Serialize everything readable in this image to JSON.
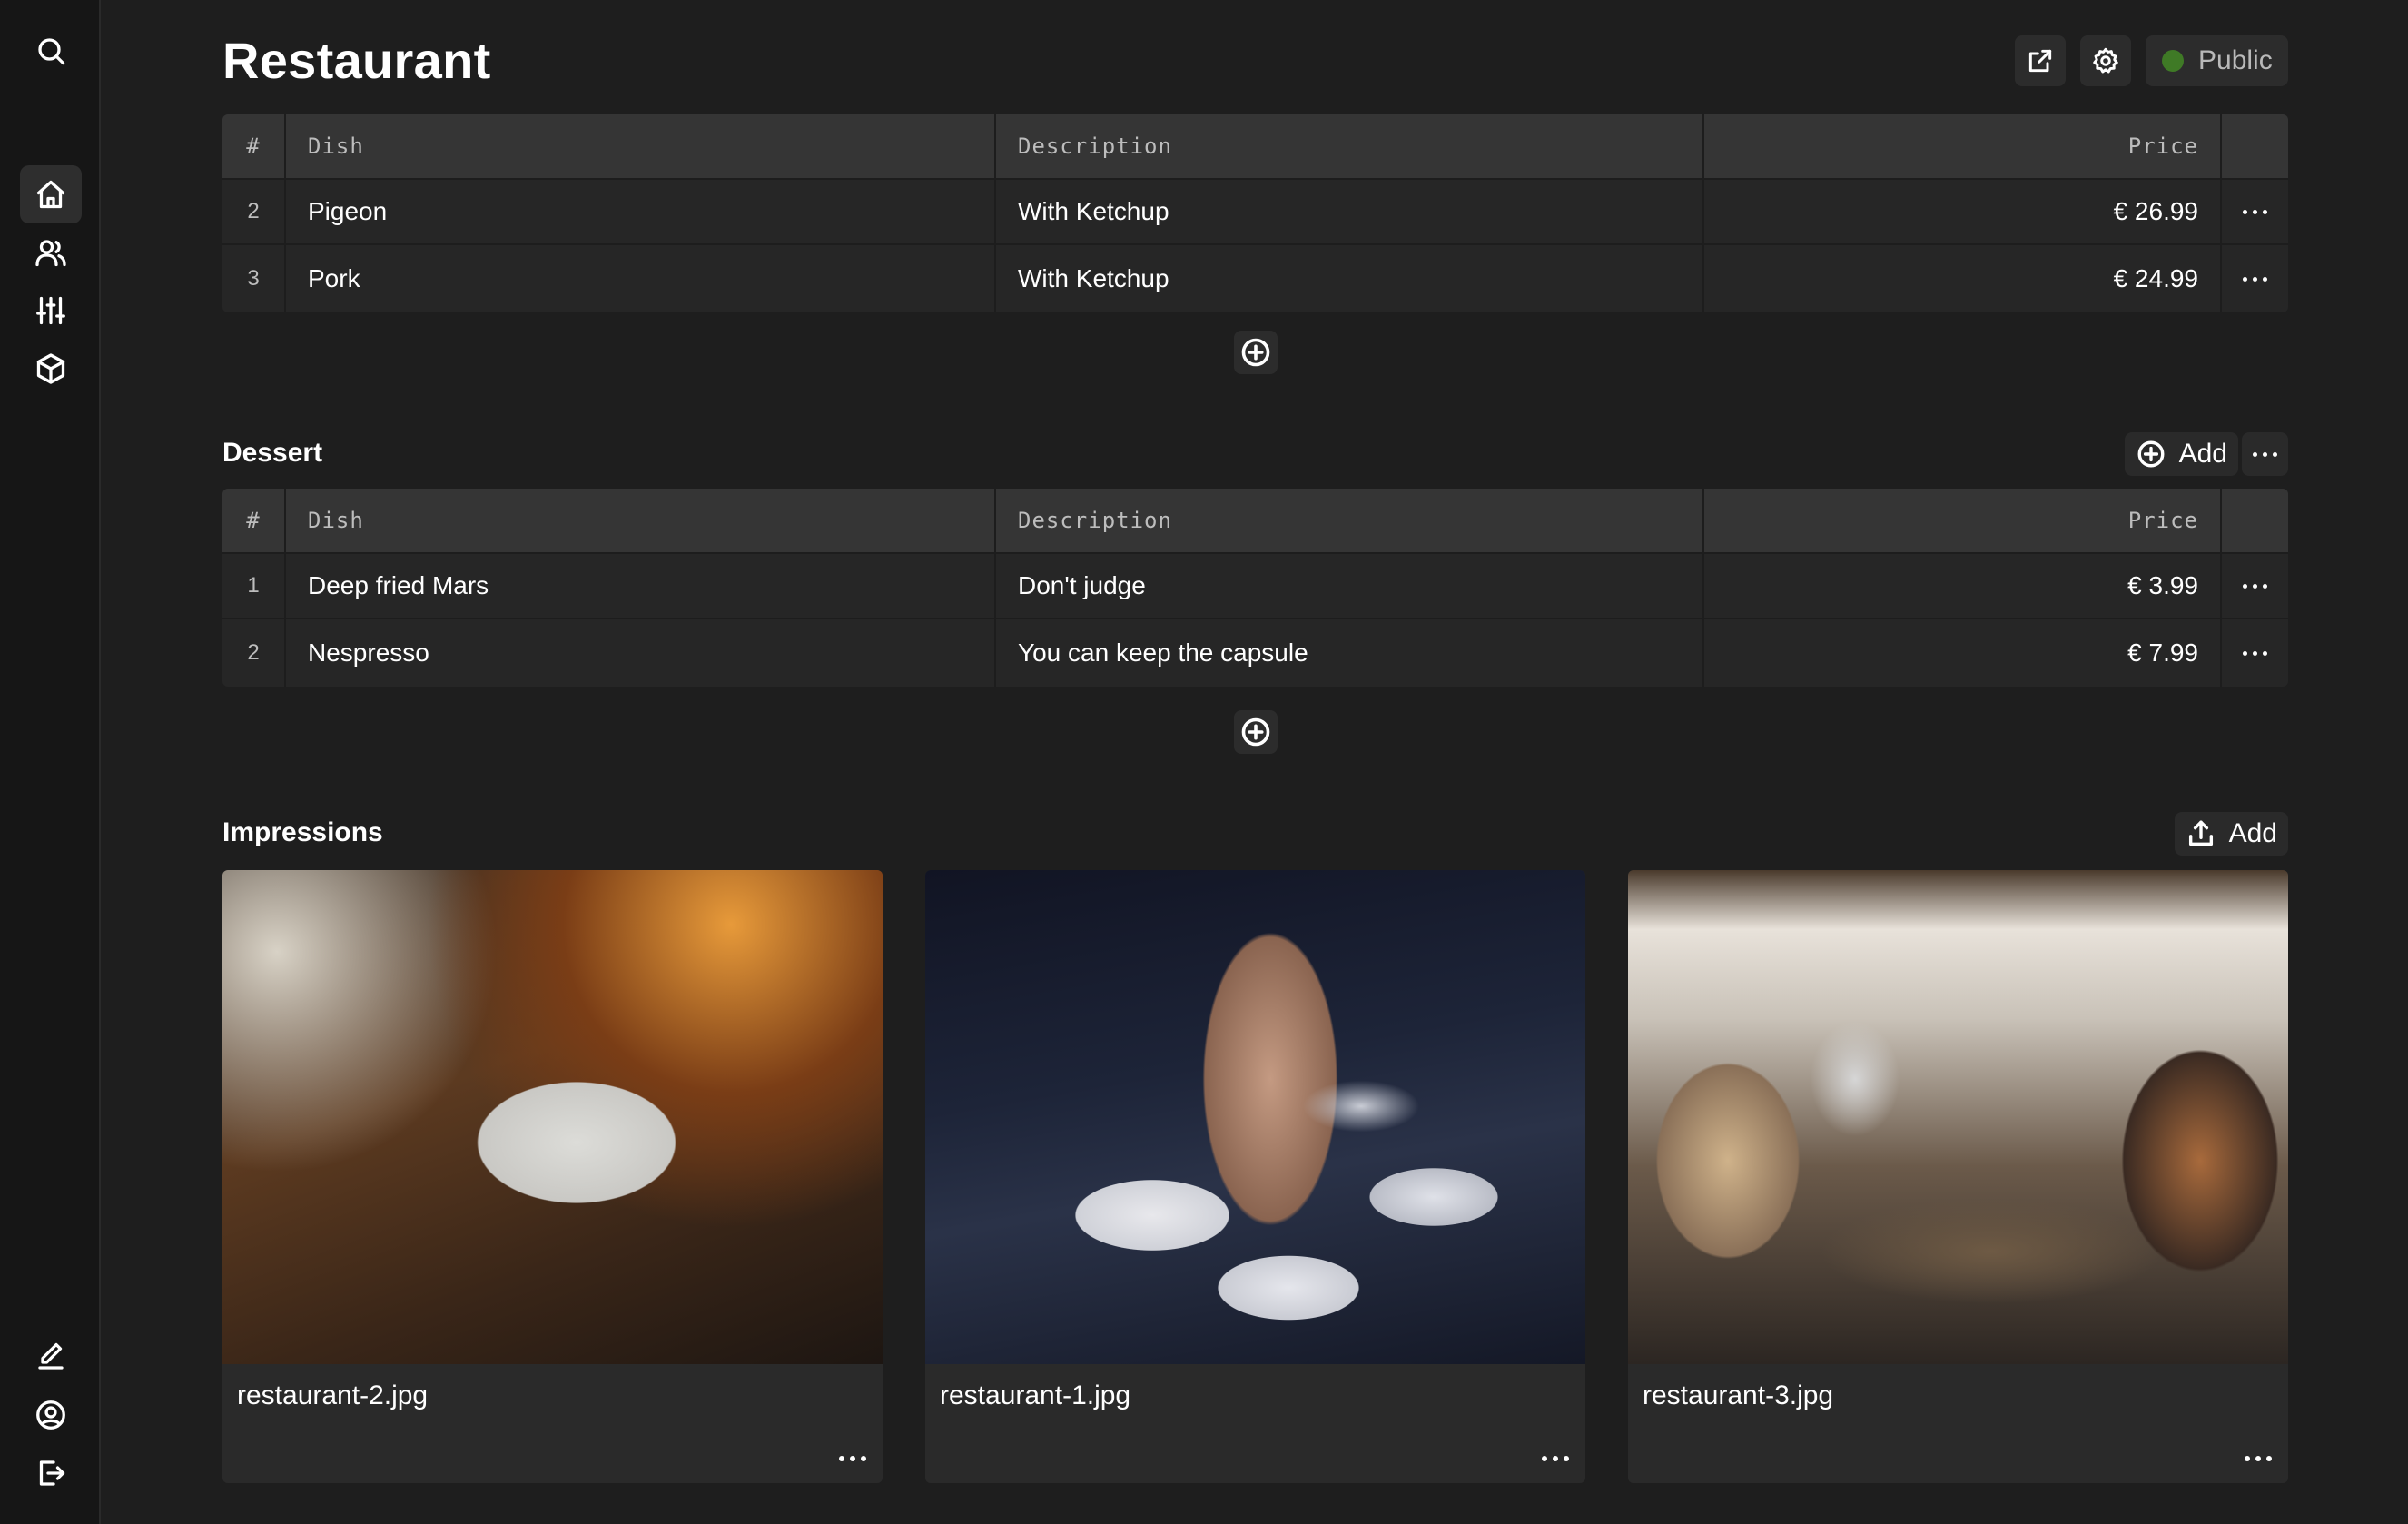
{
  "page": {
    "title": "Restaurant",
    "visibility_label": "Public",
    "colors": {
      "background": "#1e1e1e",
      "sidebar": "#161616",
      "status_public": "#3f7a26"
    }
  },
  "sidebar": {
    "top": [
      {
        "icon": "search-icon"
      }
    ],
    "nav": [
      {
        "icon": "home-icon",
        "active": true
      },
      {
        "icon": "users-icon"
      },
      {
        "icon": "sliders-icon"
      },
      {
        "icon": "box-icon"
      }
    ],
    "bottom": [
      {
        "icon": "edit-icon"
      },
      {
        "icon": "user-circle-icon"
      },
      {
        "icon": "logout-icon"
      }
    ]
  },
  "main_table": {
    "columns": [
      "#",
      "Dish",
      "Description",
      "Price"
    ],
    "rows": [
      {
        "num": "2",
        "dish": "Pigeon",
        "description": "With Ketchup",
        "price": "€ 26.99"
      },
      {
        "num": "3",
        "dish": "Pork",
        "description": "With Ketchup",
        "price": "€ 24.99"
      }
    ]
  },
  "dessert": {
    "title": "Dessert",
    "add_label": "Add",
    "columns": [
      "#",
      "Dish",
      "Description",
      "Price"
    ],
    "rows": [
      {
        "num": "1",
        "dish": "Deep fried Mars",
        "description": "Don't judge",
        "price": "€ 3.99"
      },
      {
        "num": "2",
        "dish": "Nespresso",
        "description": "You can keep the capsule",
        "price": "€ 7.99"
      }
    ]
  },
  "impressions": {
    "title": "Impressions",
    "add_label": "Add",
    "images": [
      {
        "filename": "restaurant-2.jpg"
      },
      {
        "filename": "restaurant-1.jpg"
      },
      {
        "filename": "restaurant-3.jpg"
      }
    ]
  }
}
